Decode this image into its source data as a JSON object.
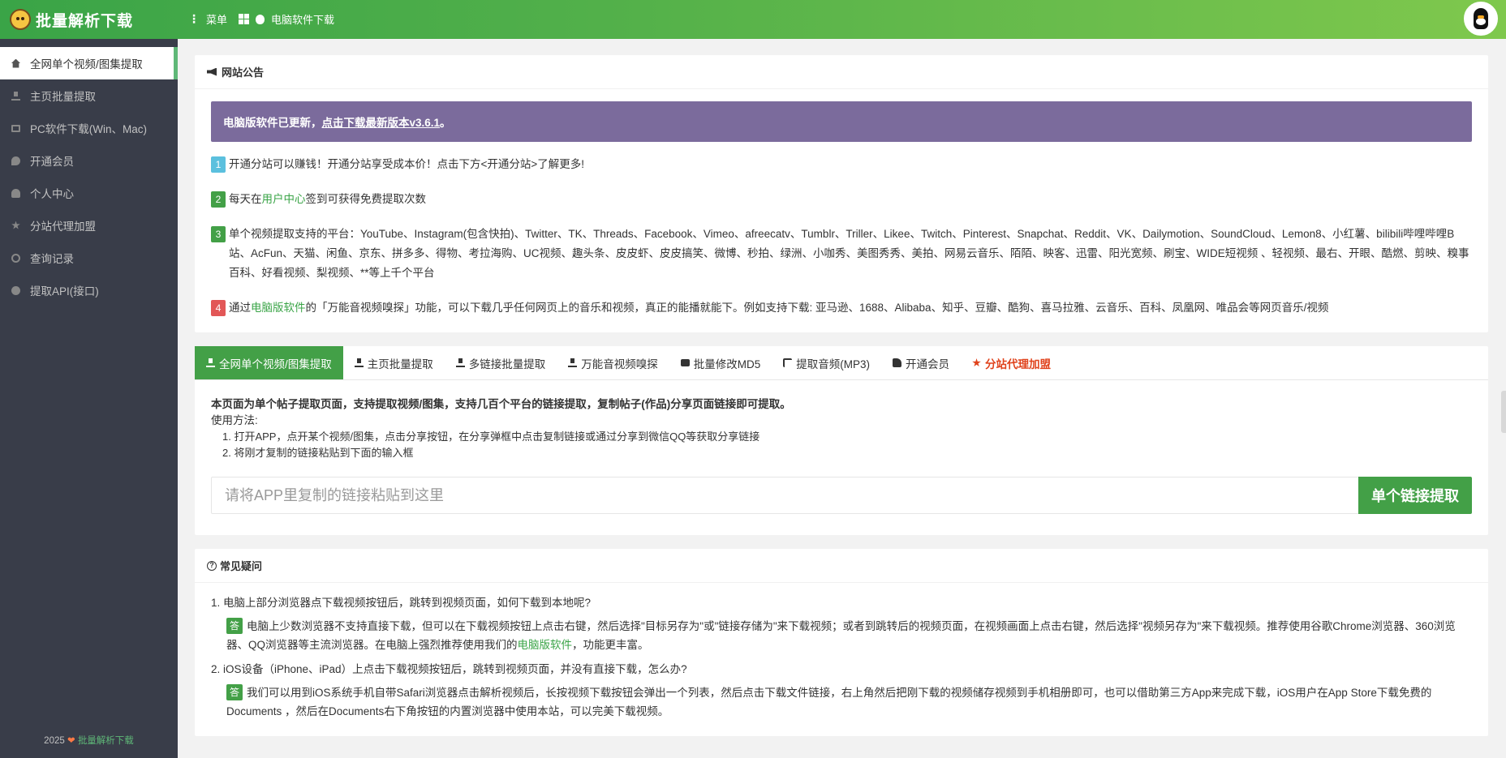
{
  "topbar": {
    "brand": "批量解析下载",
    "menu_label": "菜单",
    "software_label": "电脑软件下载"
  },
  "sidebar": {
    "items": [
      {
        "label": "全网单个视频/图集提取",
        "icon": "home-icon"
      },
      {
        "label": "主页批量提取",
        "icon": "download-icon"
      },
      {
        "label": "PC软件下载(Win、Mac)",
        "icon": "desktop-icon"
      },
      {
        "label": "开通会员",
        "icon": "vip-icon"
      },
      {
        "label": "个人中心",
        "icon": "user-icon"
      },
      {
        "label": "分站代理加盟",
        "icon": "star-icon"
      },
      {
        "label": "查询记录",
        "icon": "search-icon"
      },
      {
        "label": "提取API(接口)",
        "icon": "github-icon"
      }
    ],
    "footer_year": "2025",
    "footer_heart": "❤",
    "footer_brand": "批量解析下载"
  },
  "notice": {
    "title": "网站公告",
    "update_prefix": "电脑版软件已更新，",
    "update_link": "点击下载最新版本v3.6.1",
    "update_suffix": "。",
    "line1_badge": "1",
    "line1_text": "开通分站可以赚钱！开通分站享受成本价！点击下方<开通分站>了解更多!",
    "line2_badge": "2",
    "line2_pre": "每天在",
    "line2_link": "用户中心",
    "line2_post": "签到可获得免费提取次数",
    "line3_badge": "3",
    "line3_text": "单个视频提取支持的平台：YouTube、Instagram(包含快拍)、Twitter、TK、Threads、Facebook、Vimeo、afreecatv、Tumblr、Triller、Likee、Twitch、Pinterest、Snapchat、Reddit、VK、Dailymotion、SoundCloud、Lemon8、小红薯、bilibili哔哩哔哩B站、AcFun、天猫、闲鱼、京东、拼多多、得物、考拉海购、UC视频、趣头条、皮皮虾、皮皮搞笑、微博、秒拍、绿洲、小咖秀、美图秀秀、美拍、网易云音乐、陌陌、映客、迅雷、阳光宽频、刷宝、WIDE短视频 、轻视频、最右、开眼、酷燃、剪映、糗事百科、好看视频、梨视频、**等上千个平台",
    "line4_badge": "4",
    "line4_pre": "通过",
    "line4_link": "电脑版软件",
    "line4_post": "的「万能音视频嗅探」功能，可以下载几乎任何网页上的音乐和视频，真正的能播就能下。例如支持下载: 亚马逊、1688、Alibaba、知乎、豆瓣、酷狗、喜马拉雅、云音乐、百科、凤凰网、唯品会等网页音乐/视频"
  },
  "tabs": [
    {
      "label": "全网单个视频/图集提取",
      "icon": "download-icon"
    },
    {
      "label": "主页批量提取",
      "icon": "download-icon"
    },
    {
      "label": "多链接批量提取",
      "icon": "download-icon"
    },
    {
      "label": "万能音视频嗅探",
      "icon": "download-icon"
    },
    {
      "label": "批量修改MD5",
      "icon": "video-camera-icon"
    },
    {
      "label": "提取音频(MP3)",
      "icon": "music-note-icon"
    },
    {
      "label": "开通会员",
      "icon": "thumbs-up-icon"
    },
    {
      "label": "分站代理加盟",
      "icon": "star-icon"
    }
  ],
  "extract": {
    "intro": "本页面为单个帖子提取页面，支持提取视频/图集，支持几百个平台的链接提取，复制帖子(作品)分享页面链接即可提取。",
    "usage_label": "使用方法:",
    "step1": "1. 打开APP，点开某个视频/图集，点击分享按钮，在分享弹框中点击复制链接或通过分享到微信QQ等获取分享链接",
    "step2": "2. 将刚才复制的链接粘贴到下面的输入框",
    "input_placeholder": "请将APP里复制的链接粘贴到这里",
    "input_value": "",
    "button_label": "单个链接提取"
  },
  "faq": {
    "title": "常见疑问",
    "answer_badge": "答",
    "q1": "1. 电脑上部分浏览器点下载视频按钮后，跳转到视频页面，如何下载到本地呢?",
    "a1_pre": "电脑上少数浏览器不支持直接下载，但可以在下载视频按钮上点击右键，然后选择\"目标另存为\"或\"链接存储为\"来下载视频；或者到跳转后的视频页面，在视频画面上点击右键，然后选择\"视频另存为\"来下载视频。推荐使用谷歌Chrome浏览器、360浏览器、QQ浏览器等主流浏览器。在电脑上强烈推荐使用我们的",
    "a1_link": "电脑版软件",
    "a1_post": "，功能更丰富。",
    "q2": "2. iOS设备（iPhone、iPad）上点击下载视频按钮后，跳转到视频页面，并没有直接下载，怎么办?",
    "a2": "我们可以用到iOS系统手机自带Safari浏览器点击解析视频后，长按视频下载按钮会弹出一个列表，然后点击下载文件链接，右上角然后把刚下载的视频储存视频到手机相册即可，也可以借助第三方App来完成下载，iOS用户在App Store下载免费的Documents ，然后在Documents右下角按钮的内置浏览器中使用本站，可以完美下载视频。"
  },
  "colors": {
    "accent_green": "#43a047",
    "sidebar_bg": "#393d49",
    "notice_purple": "#7b6b9c",
    "hot_tab_red": "#e0421b"
  }
}
